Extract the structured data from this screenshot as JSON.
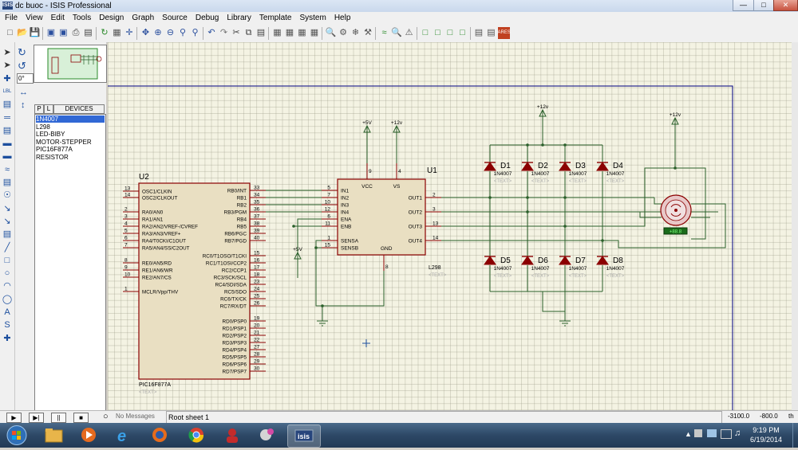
{
  "window": {
    "title": "dc buoc - ISIS Professional",
    "app_icon": "ISIS"
  },
  "menu": [
    "File",
    "View",
    "Edit",
    "Tools",
    "Design",
    "Graph",
    "Source",
    "Debug",
    "Library",
    "Template",
    "System",
    "Help"
  ],
  "rotation": {
    "angle": "0°"
  },
  "devices": {
    "tabs": {
      "p": "P",
      "l": "L",
      "label": "DEVICES"
    },
    "items": [
      "1N4007",
      "L298",
      "LED-BIBY",
      "MOTOR-STEPPER",
      "PIC16F877A",
      "RESISTOR"
    ],
    "selected_index": 0
  },
  "schematic": {
    "u2": {
      "ref": "U2",
      "part": "PIC16F877A",
      "text": "<TEXT>",
      "left_pins": [
        {
          "num": "13",
          "name": "OSC1/CLKIN"
        },
        {
          "num": "14",
          "name": "OSC2/CLKOUT"
        },
        {
          "num": "2",
          "name": "RA0/AN0"
        },
        {
          "num": "3",
          "name": "RA1/AN1"
        },
        {
          "num": "4",
          "name": "RA2/AN2/VREF-/CVREF"
        },
        {
          "num": "5",
          "name": "RA3/AN3/VREF+"
        },
        {
          "num": "6",
          "name": "RA4/T0CKI/C1OUT"
        },
        {
          "num": "7",
          "name": "RA5/AN4/SS/C2OUT"
        },
        {
          "num": "8",
          "name": "RE0/AN5/RD"
        },
        {
          "num": "9",
          "name": "RE1/AN6/WR"
        },
        {
          "num": "10",
          "name": "RE2/AN7/CS"
        },
        {
          "num": "1",
          "name": "MCLR/Vpp/THV"
        }
      ],
      "right_pins": [
        {
          "num": "33",
          "name": "RB0/INT"
        },
        {
          "num": "34",
          "name": "RB1"
        },
        {
          "num": "35",
          "name": "RB2"
        },
        {
          "num": "36",
          "name": "RB3/PGM"
        },
        {
          "num": "37",
          "name": "RB4"
        },
        {
          "num": "38",
          "name": "RB5"
        },
        {
          "num": "39",
          "name": "RB6/PGC"
        },
        {
          "num": "40",
          "name": "RB7/PGD"
        },
        {
          "num": "15",
          "name": "RC0/T1OSO/T1CKI"
        },
        {
          "num": "16",
          "name": "RC1/T1OSI/CCP2"
        },
        {
          "num": "17",
          "name": "RC2/CCP1"
        },
        {
          "num": "18",
          "name": "RC3/SCK/SCL"
        },
        {
          "num": "23",
          "name": "RC4/SDI/SDA"
        },
        {
          "num": "24",
          "name": "RC5/SDO"
        },
        {
          "num": "25",
          "name": "RC6/TX/CK"
        },
        {
          "num": "26",
          "name": "RC7/RX/DT"
        },
        {
          "num": "19",
          "name": "RD0/PSP0"
        },
        {
          "num": "20",
          "name": "RD1/PSP1"
        },
        {
          "num": "21",
          "name": "RD2/PSP2"
        },
        {
          "num": "22",
          "name": "RD3/PSP3"
        },
        {
          "num": "27",
          "name": "RD4/PSP4"
        },
        {
          "num": "28",
          "name": "RD5/PSP5"
        },
        {
          "num": "29",
          "name": "RD6/PSP6"
        },
        {
          "num": "30",
          "name": "RD7/PSP7"
        }
      ]
    },
    "u1": {
      "ref": "U1",
      "part": "L298",
      "text": "<TEXT>",
      "left_pins": [
        {
          "num": "5",
          "name": "IN1"
        },
        {
          "num": "7",
          "name": "IN2"
        },
        {
          "num": "10",
          "name": "IN3"
        },
        {
          "num": "12",
          "name": "IN4"
        },
        {
          "num": "6",
          "name": "ENA"
        },
        {
          "num": "11",
          "name": "ENB"
        },
        {
          "num": "1",
          "name": "SENSA"
        },
        {
          "num": "15",
          "name": "SENSB"
        }
      ],
      "right_pins": [
        {
          "num": "2",
          "name": "OUT1"
        },
        {
          "num": "3",
          "name": "OUT2"
        },
        {
          "num": "13",
          "name": "OUT3"
        },
        {
          "num": "14",
          "name": "OUT4"
        }
      ],
      "top_pins": [
        {
          "num": "9",
          "name": "VCC"
        },
        {
          "num": "4",
          "name": "VS"
        }
      ],
      "bottom_pin": {
        "num": "8",
        "name": "GND"
      }
    },
    "power": {
      "p5v_a": "+5V",
      "p12v_a": "+12v",
      "p12v_b": "+12v",
      "p12v_c": "+12v",
      "p5v_b": "+5V"
    },
    "diodes_top": [
      {
        "ref": "D1",
        "part": "1N4007",
        "text": "<TEXT>"
      },
      {
        "ref": "D2",
        "part": "1N4007",
        "text": "<TEXT>"
      },
      {
        "ref": "D3",
        "part": "1N4007",
        "text": "<TEXT>"
      },
      {
        "ref": "D4",
        "part": "1N4007",
        "text": "<TEXT>"
      }
    ],
    "diodes_bottom": [
      {
        "ref": "D5",
        "part": "1N4007",
        "text": "<TEXT>"
      },
      {
        "ref": "D6",
        "part": "1N4007",
        "text": "<TEXT>"
      },
      {
        "ref": "D7",
        "part": "1N4007",
        "text": "<TEXT>"
      },
      {
        "ref": "D8",
        "part": "1N4007",
        "text": "<TEXT>"
      }
    ],
    "motor": {
      "readout": "+88.8"
    }
  },
  "status": {
    "message": "No Messages",
    "sheet": "Root sheet 1",
    "x": "-3100.0",
    "y": "-800.0",
    "unit": "th"
  },
  "taskbar": {
    "time": "9:19 PM",
    "date": "6/19/2014"
  },
  "colors": {
    "component": "#8b0000",
    "wire": "#2a5f2a",
    "canvas": "#f4f3e3",
    "selection": "#3168d5",
    "sheet_border": "#000080"
  }
}
